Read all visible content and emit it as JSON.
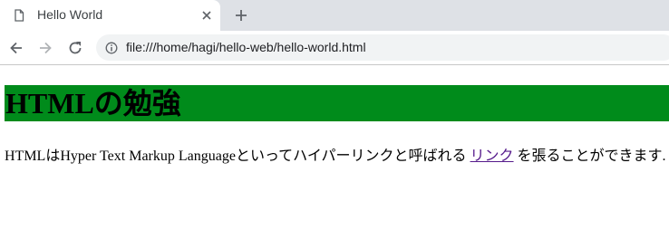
{
  "tab": {
    "title": "Hello World"
  },
  "address_bar": {
    "url": "file:///home/hagi/hello-web/hello-world.html"
  },
  "page": {
    "heading": "HTMLの勉強",
    "paragraph_before": "HTMLはHyper Text Markup Languageといってハイパーリンクと呼ばれる ",
    "link_text": "リンク",
    "paragraph_after": " を張ることができます."
  },
  "colors": {
    "heading_background": "#008b1b",
    "visited_link": "#551a8b",
    "tabstrip": "#dee1e6"
  },
  "icons": [
    "page-icon",
    "close-icon",
    "new-tab-icon",
    "back-icon",
    "forward-icon",
    "reload-icon",
    "info-icon"
  ]
}
